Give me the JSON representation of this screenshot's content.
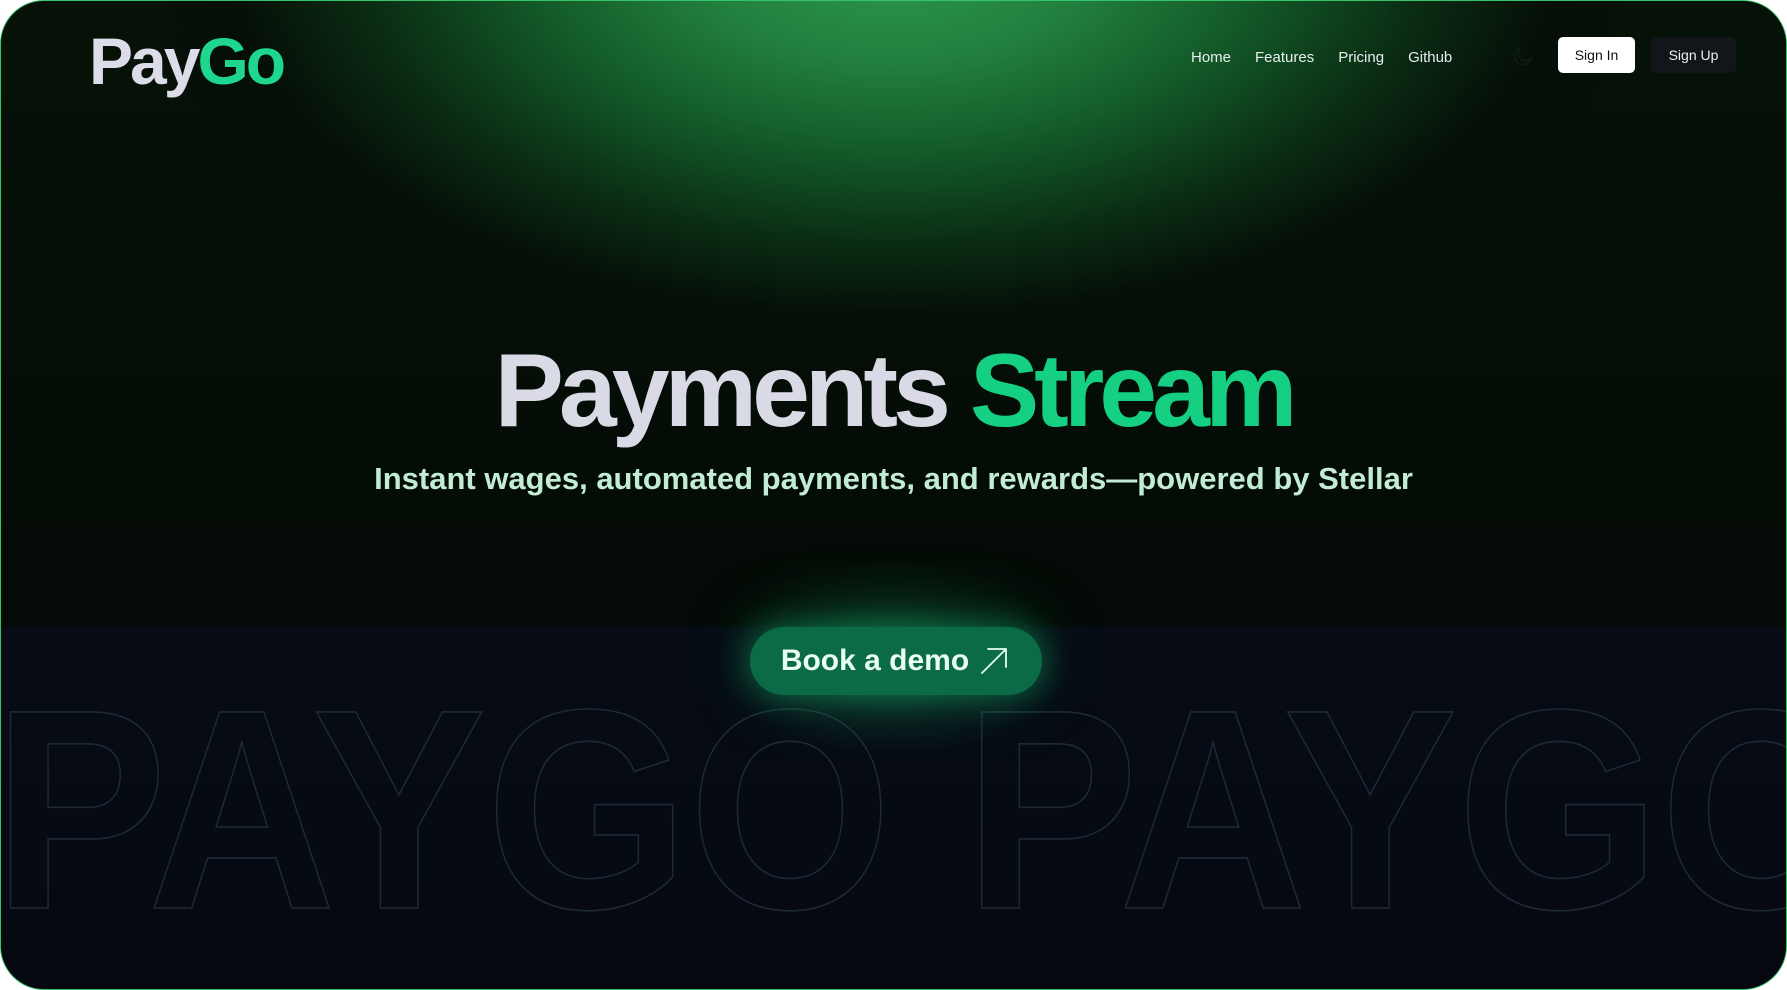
{
  "brand": {
    "part1": "Pay",
    "part2": "Go"
  },
  "nav": {
    "items": [
      "Home",
      "Features",
      "Pricing",
      "Github"
    ]
  },
  "header": {
    "theme_toggle_icon": "moon-icon",
    "sign_in_label": "Sign In",
    "sign_up_label": "Sign Up"
  },
  "hero": {
    "title_part1": "Payments",
    "title_part2": "Stream",
    "subtitle": "Instant wages, automated payments, and rewards—powered by Stellar",
    "cta_label": "Book a demo",
    "cta_icon": "arrow-up-right-icon"
  },
  "watermark": {
    "text": "PAYGO PAYGO"
  },
  "colors": {
    "accent": "#15cf83",
    "button_bg": "#0b6b47",
    "frame_border": "#35c46a"
  }
}
